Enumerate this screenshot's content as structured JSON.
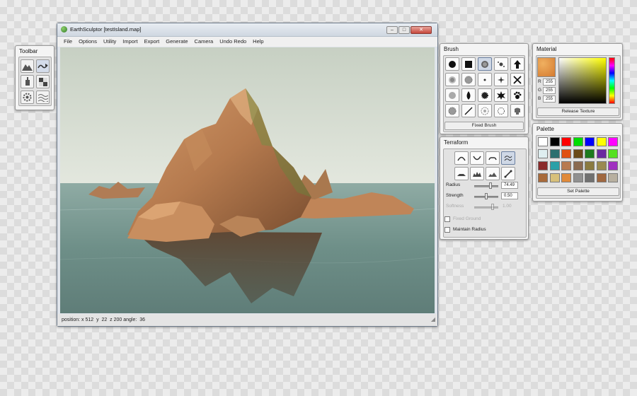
{
  "app": {
    "title": "EarthSculptor [testIsland.map]",
    "menu": [
      "File",
      "Options",
      "Utility",
      "Import",
      "Export",
      "Generate",
      "Camera",
      "Undo Redo",
      "Help"
    ],
    "status": {
      "label": "position:",
      "x_label": "x",
      "x": "512",
      "y_label": "y",
      "y": "22",
      "z_label": "z",
      "z": "200",
      "angle_label": "angle:",
      "angle": "36"
    }
  },
  "toolbar": {
    "title": "Toolbar",
    "icons": [
      "mountain-icon",
      "raise-lower-icon",
      "paint-bucket-icon",
      "checker-texture-icon",
      "gear-icon",
      "water-icon"
    ]
  },
  "brush": {
    "title": "Brush",
    "fixed_label": "Fixed Brush",
    "selected_index": 2
  },
  "terraform": {
    "title": "Terraform",
    "radius_label": "Radius",
    "radius_value": "74.49",
    "radius_level": 0.7,
    "strength_label": "Strength",
    "strength_value": "0.50",
    "strength_level": 0.5,
    "softness_label": "Softness",
    "softness_value": "1.00",
    "softness_level": 0.8,
    "check1_label": "Fixed Ground",
    "check2_label": "Maintain Radius"
  },
  "material": {
    "title": "Material",
    "r_label": "R",
    "r": "255",
    "g_label": "G",
    "g": "255",
    "b_label": "B",
    "b": "255",
    "release_label": "Release Texture"
  },
  "palette": {
    "title": "Palette",
    "set_label": "Set Palette",
    "colors": [
      "#ffffff",
      "#000000",
      "#ff0000",
      "#00dd00",
      "#0000ff",
      "#ffff00",
      "#ff00ff",
      "#dfeef0",
      "#2b6f6f",
      "#e05010",
      "#6a4a18",
      "#1d7a1d",
      "#6a2aa0",
      "#55e020",
      "#8a2a2a",
      "#2aa0a8",
      "#b87a50",
      "#8a6a50",
      "#8a7a40",
      "#9a8a50",
      "#a030c0",
      "#a86a3a",
      "#d8c07a",
      "#e08a3a",
      "#909090",
      "#707070",
      "#a06840",
      "#b8b0a0"
    ]
  }
}
